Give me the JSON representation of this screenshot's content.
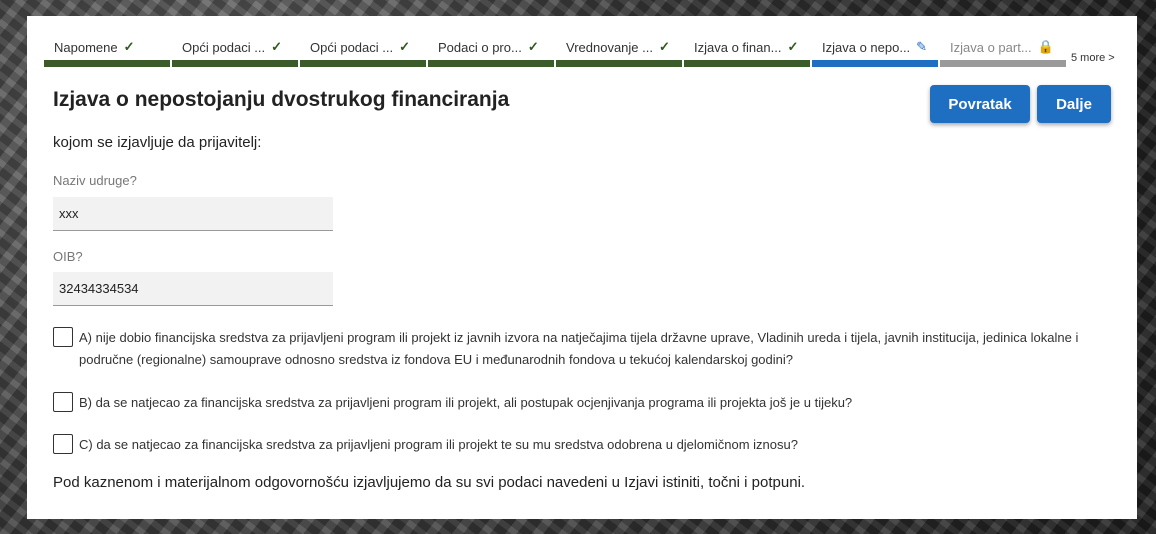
{
  "stepper": {
    "steps": [
      {
        "label": "Napomene",
        "state": "done",
        "icon": "check-icon"
      },
      {
        "label": "Opći podaci ...",
        "state": "done",
        "icon": "check-icon"
      },
      {
        "label": "Opći podaci ...",
        "state": "done",
        "icon": "check-icon"
      },
      {
        "label": "Podaci o pro...",
        "state": "done",
        "icon": "check-icon"
      },
      {
        "label": "Vrednovanje ...",
        "state": "done",
        "icon": "check-icon"
      },
      {
        "label": "Izjava o finan...",
        "state": "done",
        "icon": "check-icon"
      },
      {
        "label": "Izjava o nepo...",
        "state": "current",
        "icon": "pencil-icon"
      },
      {
        "label": "Izjava o part...",
        "state": "locked",
        "icon": "lock-icon"
      }
    ],
    "more_label": "5 more >"
  },
  "page": {
    "title": "Izjava o nepostojanju dvostrukog financiranja",
    "subtitle": "kojom se izjavljuje da prijavitelj:"
  },
  "buttons": {
    "back_label": "Povratak",
    "next_label": "Dalje"
  },
  "form": {
    "name_label": "Naziv udruge?",
    "name_value": "xxx",
    "oib_label": "OIB?",
    "oib_value": "32434334534"
  },
  "options": [
    {
      "text": "A) nije dobio financijska sredstva za prijavljeni program ili projekt iz javnih izvora na natječajima tijela državne uprave, Vladinih ureda i tijela, javnih institucija, jedinica lokalne i područne (regionalne) samouprave odnosno sredstva iz fondova EU i međunarodnih fondova u tekućoj kalendarskoj godini?",
      "checked": false
    },
    {
      "text": "B) da se natjecao za financijska sredstva za prijavljeni program ili projekt, ali postupak ocjenjivanja programa ili projekta još je u tijeku?",
      "checked": false
    },
    {
      "text": "C) da se natjecao za financijska sredstva za prijavljeni program ili projekt te su mu sredstva odobrena u djelomičnom iznosu?",
      "checked": false
    }
  ],
  "footer": {
    "statement": "Pod kaznenom i materijalnom odgovornošću izjavljujemo da su svi podaci navedeni u Izjavi istiniti, točni i potpuni."
  },
  "colors": {
    "accent": "#1e6fc2",
    "done_bar": "#3b5b2a",
    "locked_bar": "#9a9a9a"
  }
}
